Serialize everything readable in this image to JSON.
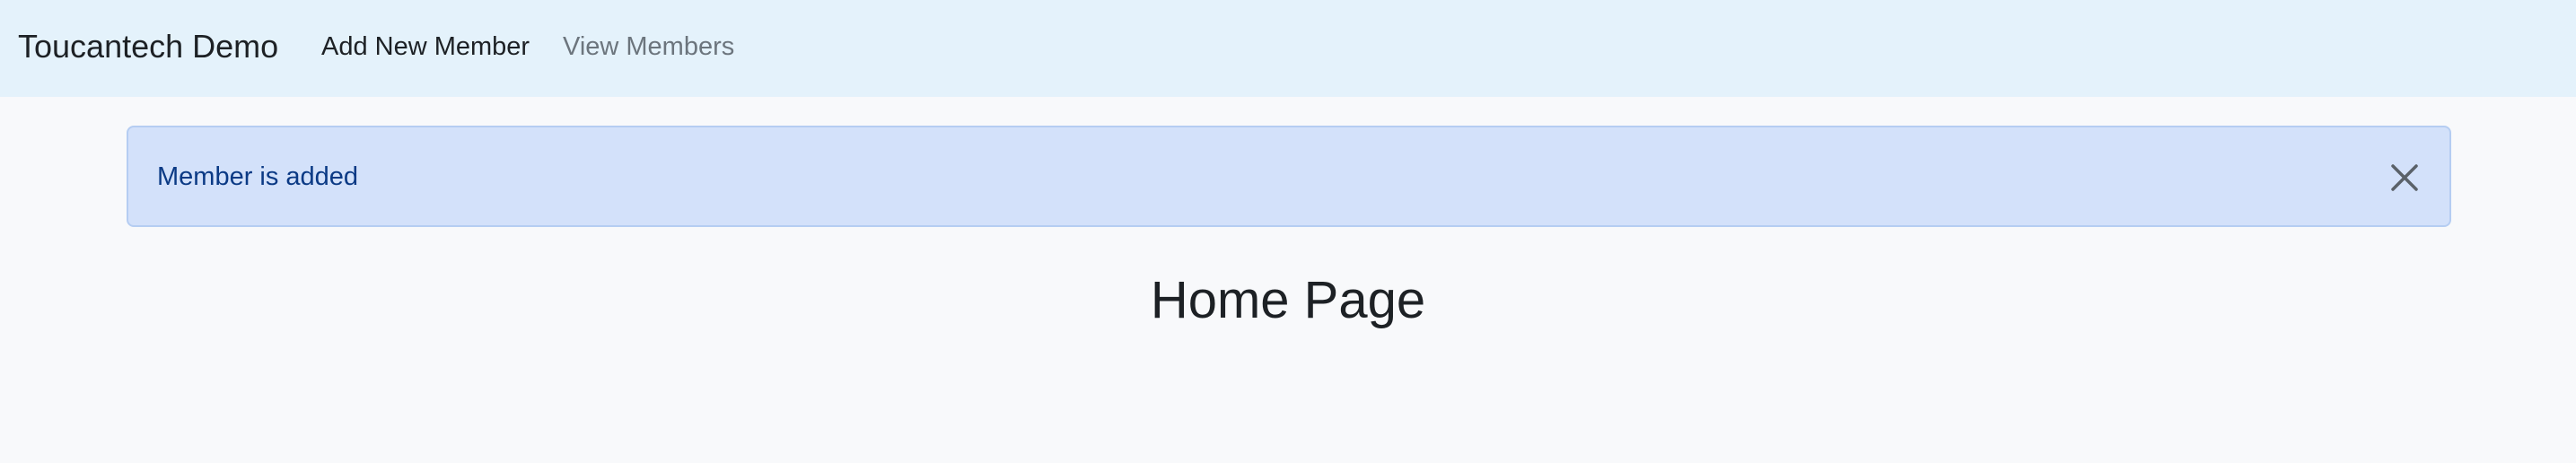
{
  "navbar": {
    "brand": "Toucantech Demo",
    "links": [
      {
        "label": "Add New Member",
        "active": true
      },
      {
        "label": "View Members",
        "active": false
      }
    ]
  },
  "alert": {
    "message": "Member is added",
    "close_icon": "close-icon"
  },
  "main": {
    "title": "Home Page"
  },
  "colors": {
    "navbar_bg": "#e4f2fb",
    "page_bg": "#f8f9fb",
    "alert_bg": "#d3e1fa",
    "alert_border": "#b5cdf2",
    "alert_text": "#0b3a85",
    "muted_link": "#6c757d"
  }
}
